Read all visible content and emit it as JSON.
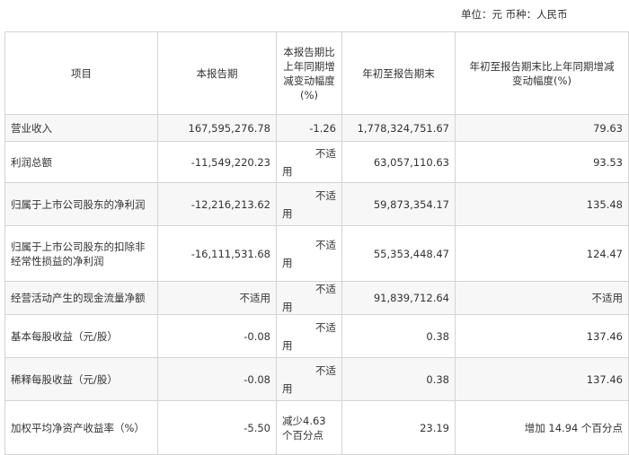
{
  "unit_note": "单位：元  币种：人民币",
  "headers": {
    "item": "项目",
    "current": "本报告期",
    "current_change": "本报告期比上年同期增减变动幅度(%)",
    "ytd": "年初至报告期末",
    "ytd_change": "年初至报告期末比上年同期增减变动幅度(%)"
  },
  "not_applicable_split": [
    "不适",
    "用"
  ],
  "rows": [
    {
      "item": "营业收入",
      "current": "167,595,276.78",
      "current_change": "-1.26",
      "ytd": "1,778,324,751.67",
      "ytd_change": "79.63"
    },
    {
      "item": "利润总额",
      "current": "-11,549,220.23",
      "current_change": "不适用",
      "ytd": "63,057,110.63",
      "ytd_change": "93.53"
    },
    {
      "item": "归属于上市公司股东的净利润",
      "current": "-12,216,213.62",
      "current_change": "不适用",
      "ytd": "59,873,354.17",
      "ytd_change": "135.48"
    },
    {
      "item": "归属于上市公司股东的扣除非经常性损益的净利润",
      "current": "-16,111,531.68",
      "current_change": "不适用",
      "ytd": "55,353,448.47",
      "ytd_change": "124.47"
    },
    {
      "item": "经营活动产生的现金流量净额",
      "current": "不适用",
      "current_change": "不适用",
      "ytd": "91,839,712.64",
      "ytd_change": "不适用"
    },
    {
      "item": "基本每股收益（元/股）",
      "current": "-0.08",
      "current_change": "不适用",
      "ytd": "0.38",
      "ytd_change": "137.46"
    },
    {
      "item": "稀释每股收益（元/股）",
      "current": "-0.08",
      "current_change": "不适用",
      "ytd": "0.38",
      "ytd_change": "137.46"
    },
    {
      "item": "加权平均净资产收益率（%）",
      "current": "-5.50",
      "current_change": "减少4.63 个百分点",
      "ytd": "23.19",
      "ytd_change": "增加 14.94 个百分点"
    }
  ]
}
